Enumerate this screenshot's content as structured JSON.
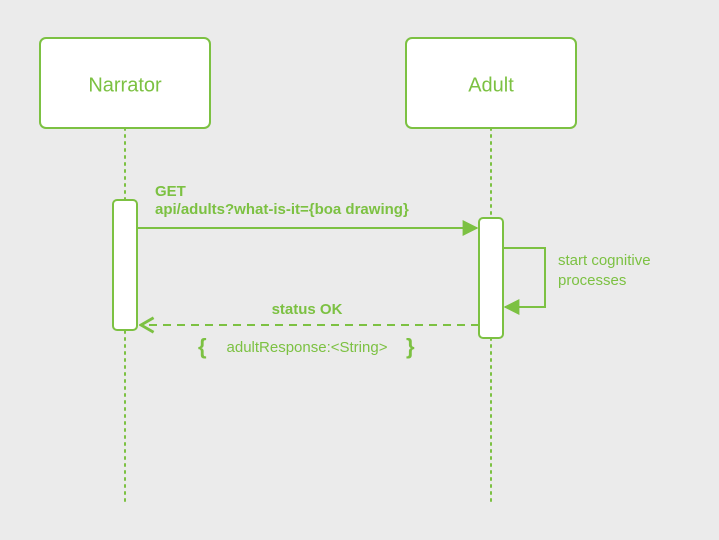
{
  "actors": {
    "left": "Narrator",
    "right": "Adult"
  },
  "messages": {
    "request_line1": "GET",
    "request_line2": "api/adults?what-is-it={boa drawing}",
    "self_line1": "start cognitive",
    "self_line2": "processes",
    "response_label": "status OK",
    "response_body": "adultResponse:<String>"
  },
  "braces": {
    "open": "{",
    "close": "}"
  }
}
